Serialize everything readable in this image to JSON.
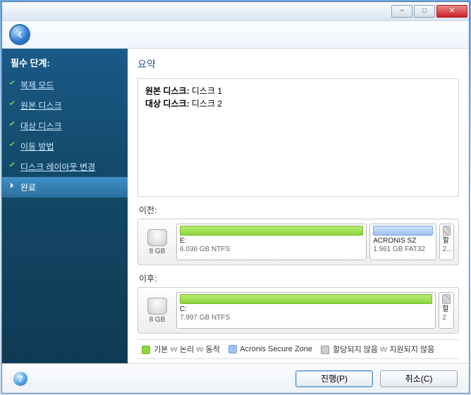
{
  "titlebar": {
    "min": "−",
    "max": "□",
    "close": "✕"
  },
  "sidebar": {
    "header": "필수 단계:",
    "steps": [
      {
        "label": "복제 모드",
        "done": true,
        "active": false
      },
      {
        "label": "원본 디스크",
        "done": true,
        "active": false
      },
      {
        "label": "대상 디스크",
        "done": true,
        "active": false
      },
      {
        "label": "이동 방법",
        "done": true,
        "active": false
      },
      {
        "label": "디스크 레이아웃 변경",
        "done": true,
        "active": false
      },
      {
        "label": "완료",
        "done": false,
        "active": true
      }
    ]
  },
  "content": {
    "title": "요약",
    "summary": {
      "src_label": "원본 디스크:",
      "src_value": "디스크 1",
      "dst_label": "대상 디스크:",
      "dst_value": "디스크 2"
    },
    "before_label": "이전:",
    "after_label": "이후:",
    "before_disk": {
      "size": "8 GB",
      "partitions": [
        {
          "kind": "primary",
          "label": "E:",
          "sub": "6.036 GB NTFS",
          "flex": 603
        },
        {
          "kind": "asz",
          "label": "ACRONIS SZ",
          "sub": "1.961 GB FAT32",
          "flex": 196
        },
        {
          "kind": "unalloc",
          "label": "할",
          "sub": "2...",
          "flex": 26
        }
      ]
    },
    "after_disk": {
      "size": "8 GB",
      "partitions": [
        {
          "kind": "primary",
          "label": "C:",
          "sub": "7.997 GB NTFS",
          "flex": 799
        },
        {
          "kind": "unalloc",
          "label": "할",
          "sub": "2",
          "flex": 26
        }
      ]
    },
    "legend": {
      "primary": "기본",
      "logical": "논리",
      "dynamic": "동적",
      "asz": "Acronis Secure Zone",
      "unalloc": "할당되지 않음",
      "unsupported": "지원되지 않음",
      "sep": "₩"
    }
  },
  "footer": {
    "proceed": "진행(P)",
    "cancel": "취소(C)"
  }
}
